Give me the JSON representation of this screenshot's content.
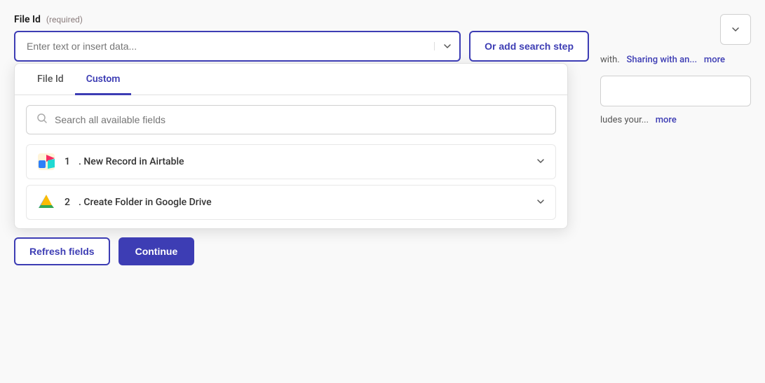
{
  "field": {
    "label": "File Id",
    "required_text": "(required)"
  },
  "input": {
    "placeholder": "Enter text or insert data...",
    "value": ""
  },
  "or_add_btn": {
    "label": "Or add search step"
  },
  "tabs": [
    {
      "id": "file-id",
      "label": "File Id",
      "active": false
    },
    {
      "id": "custom",
      "label": "Custom",
      "active": true
    }
  ],
  "search": {
    "placeholder": "Search all available fields"
  },
  "list_items": [
    {
      "id": "airtable",
      "number": "1",
      "label": "New Record in Airtable",
      "icon_type": "airtable"
    },
    {
      "id": "gdrive",
      "number": "2",
      "label": "Create Folder in Google Drive",
      "icon_type": "gdrive"
    }
  ],
  "right_panel": {
    "chevron_label": "▾",
    "text1_prefix": "with.",
    "text1_link": "Sharing with an...",
    "text1_more": "more",
    "textarea_value": "",
    "text2_prefix": "ludes your...",
    "text2_more": "more"
  },
  "bottom_buttons": {
    "refresh": "Refresh fields",
    "continue": "Continue"
  }
}
